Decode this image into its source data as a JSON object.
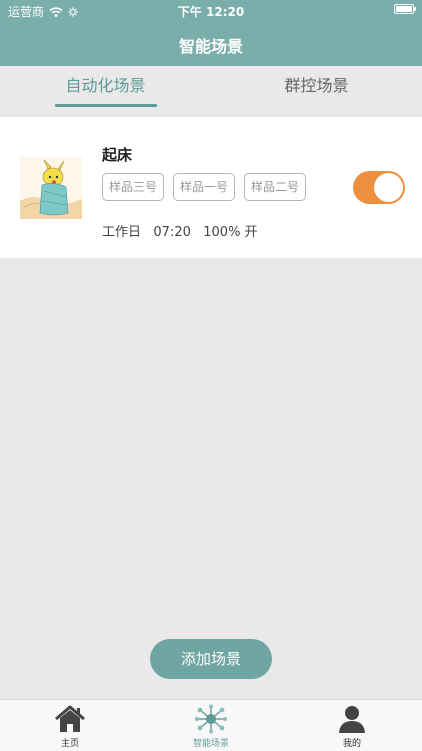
{
  "status_bar": {
    "carrier": "运营商",
    "time": "下午 12:20"
  },
  "header": {
    "title": "智能场景"
  },
  "tabs": [
    {
      "label": "自动化场景",
      "active": true
    },
    {
      "label": "群控场景",
      "active": false
    }
  ],
  "scene": {
    "name": "起床",
    "devices": [
      "样品三号",
      "样品一号",
      "样品二号"
    ],
    "schedule": "工作日   07:20   100% 开",
    "enabled": true
  },
  "add_button": {
    "label": "添加场景"
  },
  "bottom_nav": [
    {
      "label": "主页",
      "icon": "home-icon",
      "active": false
    },
    {
      "label": "智能场景",
      "icon": "scene-hub-icon",
      "active": true
    },
    {
      "label": "我的",
      "icon": "user-icon",
      "active": false
    }
  ],
  "colors": {
    "header": "#7aaeab",
    "accent": "#5f9b98",
    "toggle_on": "#ec903f",
    "add_button": "#6fa6a3"
  }
}
